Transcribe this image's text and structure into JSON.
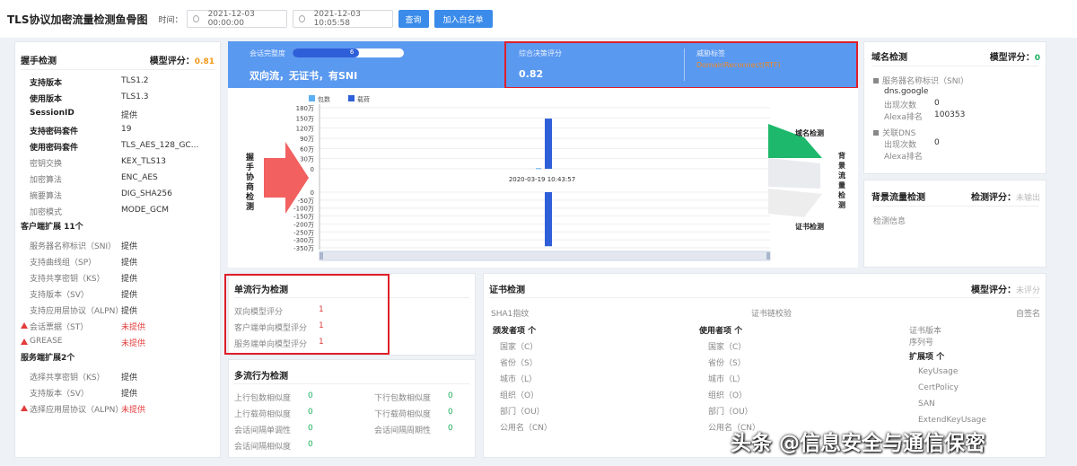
{
  "header": {
    "title": "TLS协议加密流量检测鱼骨图",
    "time_label": "时间：",
    "start_time": "2021-12-03 00:00:00",
    "end_time": "2021-12-03 10:05:58",
    "query_button": "查询",
    "whitelist_button": "加入白名单"
  },
  "handshake": {
    "title": "握手检测",
    "score_label": "模型评分：",
    "score": "0.81",
    "rows": [
      [
        "支持版本",
        "TLS1.2"
      ],
      [
        "使用版本",
        "TLS1.3"
      ],
      [
        "SessionID",
        "提供"
      ],
      [
        "支持密码套件",
        "19"
      ],
      [
        "使用密码套件",
        "TLS_AES_128_GC..."
      ],
      [
        "密钥交换",
        "KEX_TLS13"
      ],
      [
        "加密算法",
        "ENC_AES"
      ],
      [
        "摘要算法",
        "DIG_SHA256"
      ],
      [
        "加密模式",
        "MODE_GCM"
      ]
    ],
    "client_ext_title": "客户端扩展 11个",
    "client_ext": [
      [
        "服务器名称标识（SNI）",
        "提供"
      ],
      [
        "支持曲线组（SP）",
        "提供"
      ],
      [
        "支持共享密钥（KS）",
        "提供"
      ],
      [
        "支持版本（SV）",
        "提供"
      ],
      [
        "支持应用层协议（ALPN）",
        "提供"
      ],
      [
        "会话票据（ST）",
        "未提供"
      ],
      [
        "GREASE",
        "未提供"
      ]
    ],
    "server_ext_title": "服务端扩展2个",
    "server_ext": [
      [
        "选择共享密钥（KS）",
        "提供"
      ],
      [
        "支持版本（SV）",
        "提供"
      ],
      [
        "选择应用层协议（ALPN）",
        "未提供"
      ]
    ]
  },
  "banner": {
    "completeness_label": "会话完整度",
    "completeness_value": "6",
    "flow_desc": "双向流，无证书，有SNI",
    "decision_label": "综合决策评分",
    "decision_value": "0.82",
    "threat_label": "威胁标签",
    "threat_value": "DomainReconnect(RTF)"
  },
  "chart_data": {
    "type": "bar",
    "legend": [
      "包数",
      "载荷"
    ],
    "colors": [
      "#5ab0f2",
      "#2f5fd8"
    ],
    "top_axis": {
      "ticks": [
        "180万",
        "150万",
        "120万",
        "90万",
        "60万",
        "30万",
        "0"
      ],
      "ylim": [
        0,
        180
      ]
    },
    "bottom_axis": {
      "ticks": [
        "0",
        "-50万",
        "-100万",
        "-150万",
        "-200万",
        "-250万",
        "-300万",
        "-350万"
      ],
      "ylim": [
        -350,
        0
      ]
    },
    "tooltip": "2020-03-19 10:43:57",
    "points": [
      {
        "series": "载荷",
        "x": "2020-03-19 10:43:57",
        "y": 148
      },
      {
        "series": "载荷",
        "x": "2020-03-19 10:43:57",
        "y": -340
      },
      {
        "series": "包数",
        "x": "2020-03-19 10:43:57",
        "y": 2
      }
    ]
  },
  "fishbone": {
    "left_label": "握手协商检测",
    "domain_label": "域名检测",
    "background_label": "背景流量检测",
    "cert_label": "证书检测"
  },
  "domain": {
    "title": "域名检测",
    "score_label": "模型评分：",
    "score": "0",
    "sni_label": "服务器名称标识（SNI）",
    "sni_value": "dns.google",
    "count_label": "出现次数",
    "count_value": "0",
    "alexa_label": "Alexa排名",
    "alexa_value": "100353",
    "dns_label": "关联DNS",
    "dns_count_label": "出现次数",
    "dns_count_value": "0",
    "dns_alexa_label": "Alexa排名"
  },
  "bgflow": {
    "title": "背景流量检测",
    "score_label": "检测评分：",
    "score": "未输出",
    "info": "检测信息"
  },
  "single": {
    "title": "单流行为检测",
    "rows": [
      [
        "双向模型评分",
        "1"
      ],
      [
        "客户端单向模型评分",
        "1"
      ],
      [
        "服务端单向模型评分",
        "1"
      ]
    ]
  },
  "multi": {
    "title": "多流行为检测",
    "left": [
      [
        "上行包数相似度",
        "0"
      ],
      [
        "上行载荷相似度",
        "0"
      ],
      [
        "会话间隔单调性",
        "0"
      ],
      [
        "会话间隔相似度",
        "0"
      ]
    ],
    "right": [
      [
        "下行包数相似度",
        "0"
      ],
      [
        "下行载荷相似度",
        "0"
      ],
      [
        "会话间隔周期性",
        "0"
      ]
    ]
  },
  "cert": {
    "title": "证书检测",
    "score_label": "模型评分：",
    "score": "未评分",
    "sha1": "SHA1指纹",
    "chain": "证书链校验",
    "selfsigned": "自签名",
    "issuer_title": "颁发者项 个",
    "subject_title": "使用者项 个",
    "fields": [
      "国家（C）",
      "省份（S）",
      "城市（L）",
      "组织（O）",
      "部门（OU）",
      "公用名（CN）"
    ],
    "version": "证书版本",
    "serial": "序列号",
    "ext_title": "扩展项 个",
    "exts": [
      "KeyUsage",
      "CertPolicy",
      "SAN",
      "ExtendKeyUsage"
    ]
  },
  "watermark": "头条 @信息安全与通信保密"
}
